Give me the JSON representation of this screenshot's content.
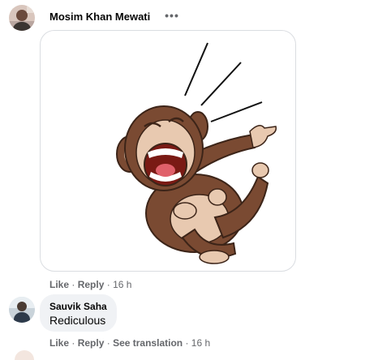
{
  "comment1": {
    "author": "Mosim Khan Mewati",
    "more_label": "•••",
    "actions": {
      "like": "Like",
      "reply": "Reply",
      "time": "16 h",
      "separator": "·"
    }
  },
  "comment2": {
    "author": "Sauvik Saha",
    "text": "Rediculous",
    "actions": {
      "like": "Like",
      "reply": "Reply",
      "translate": "See translation",
      "time": "16 h",
      "separator": "·"
    }
  },
  "colors": {
    "meta_text": "#65676b",
    "bubble_bg": "#f0f2f5",
    "card_border": "#dadde1",
    "monkey_brown": "#7a4a32"
  },
  "icons": {
    "sticker": "laughing-monkey-sticker",
    "more": "more-horizontal-icon"
  }
}
